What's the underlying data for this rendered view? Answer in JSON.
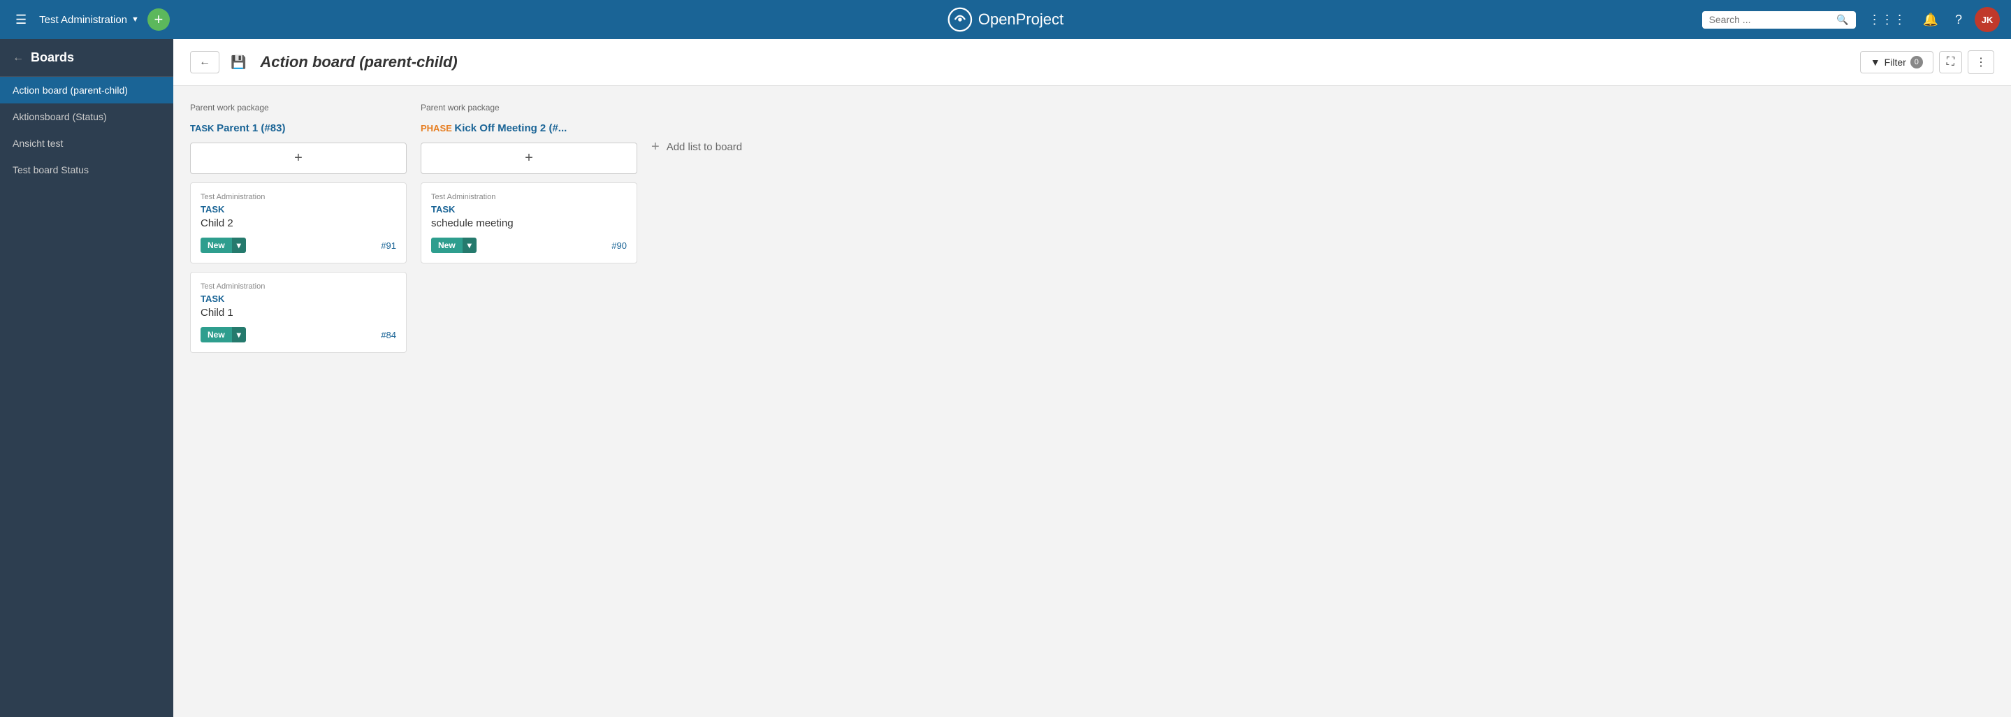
{
  "topnav": {
    "hamburger": "☰",
    "project_name": "Test Administration",
    "project_arrow": "▼",
    "plus": "+",
    "logo_text": "OpenProject",
    "search_placeholder": "Search ...",
    "avatar_initials": "JK"
  },
  "sidebar": {
    "back_arrow": "←",
    "title": "Boards",
    "items": [
      {
        "label": "Action board (parent-child)",
        "active": true
      },
      {
        "label": "Aktionsboard (Status)",
        "active": false
      },
      {
        "label": "Ansicht test",
        "active": false
      },
      {
        "label": "Test board Status",
        "active": false
      }
    ]
  },
  "board": {
    "back_arrow": "←",
    "save_icon": "💾",
    "title": "Action board (parent-child)",
    "filter_label": "Filter",
    "filter_count": "0",
    "fullscreen_icon": "⛶",
    "more_icon": "⋮",
    "add_list_label": "Add list to board",
    "columns": [
      {
        "header": "Parent work package",
        "type_label": "TASK",
        "type_class": "type-task",
        "parent_name": "Parent 1 (#83)",
        "cards": [
          {
            "project": "Test Administration",
            "type": "TASK",
            "title": "Child 2",
            "status": "New",
            "id": "#91"
          },
          {
            "project": "Test Administration",
            "type": "TASK",
            "title": "Child 1",
            "status": "New",
            "id": "#84"
          }
        ]
      },
      {
        "header": "Parent work package",
        "type_label": "PHASE",
        "type_class": "type-phase",
        "parent_name": "Kick Off Meeting 2 (#...",
        "cards": [
          {
            "project": "Test Administration",
            "type": "TASK",
            "title": "schedule meeting",
            "status": "New",
            "id": "#90"
          }
        ]
      }
    ]
  }
}
